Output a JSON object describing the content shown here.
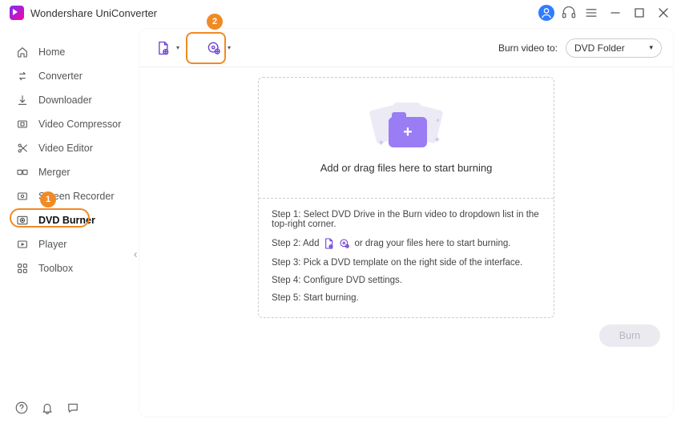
{
  "app": {
    "title": "Wondershare UniConverter"
  },
  "sidebar": {
    "items": [
      {
        "label": "Home"
      },
      {
        "label": "Converter"
      },
      {
        "label": "Downloader"
      },
      {
        "label": "Video Compressor"
      },
      {
        "label": "Video Editor"
      },
      {
        "label": "Merger"
      },
      {
        "label": "Screen Recorder"
      },
      {
        "label": "DVD Burner"
      },
      {
        "label": "Player"
      },
      {
        "label": "Toolbox"
      }
    ]
  },
  "toolbar": {
    "burn_to_label": "Burn video to:",
    "burn_to_value": "DVD Folder"
  },
  "dropzone": {
    "headline": "Add or drag files here to start burning",
    "step1": "Step 1: Select DVD Drive in the Burn video to dropdown list in the top-right corner.",
    "step2a": "Step 2: Add",
    "step2b": "or drag your files here to start burning.",
    "step3": "Step 3: Pick a DVD template on the right side of the interface.",
    "step4": "Step 4: Configure DVD settings.",
    "step5": "Step 5: Start burning."
  },
  "footer": {
    "burn_label": "Burn"
  },
  "annotations": {
    "badge1": "1",
    "badge2": "2"
  }
}
